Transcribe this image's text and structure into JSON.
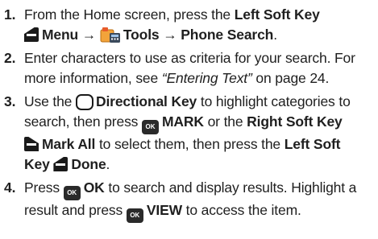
{
  "steps": [
    {
      "number": "1.",
      "t1": "From the Home screen, press the ",
      "left_soft_key": "Left Soft Key",
      "menu": "Menu",
      "arrow1": " → ",
      "tools": "Tools",
      "arrow2": " → ",
      "phone_search": "Phone Search",
      "end": "."
    },
    {
      "number": "2.",
      "line1": "Enter characters to use as criteria for your search. For",
      "l2a": "more information, see ",
      "link": "“Entering Text”",
      "l2b": " on page 24."
    },
    {
      "number": "3.",
      "t1": "Use the ",
      "directional_key": "Directional Key",
      "t2": " to highlight categories to",
      "t3": "search, then press ",
      "mark": "MARK",
      "t4": " or the ",
      "right_soft_key": "Right Soft Key",
      "mark_all": "Mark All",
      "t5": " to select them, then press the ",
      "left_soft": "Left Soft",
      "key": "Key",
      "done": "Done",
      "end": "."
    },
    {
      "number": "4.",
      "t1": "Press ",
      "ok": "OK",
      "t2": " to search and display results. Highlight a",
      "t3": "result and press ",
      "view": "VIEW",
      "t4": " to access the item."
    }
  ],
  "icons": {
    "left_soft_key": "left-soft-key-icon",
    "right_soft_key": "right-soft-key-icon",
    "tools": "tools-icon",
    "directional_key": "directional-key-icon",
    "ok_key": "ok-key-icon",
    "ok_key_label": "OK"
  }
}
